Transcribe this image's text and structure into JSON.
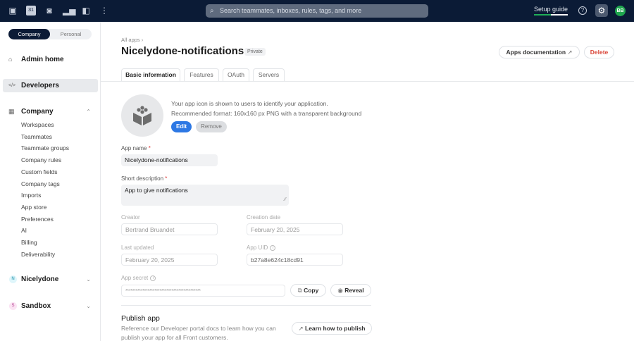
{
  "topbar": {
    "icons": [
      "inbox-icon",
      "calendar-icon",
      "contacts-icon",
      "analytics-icon",
      "knowledge-base-icon",
      "more-icon"
    ],
    "calendar_day": "31",
    "search_placeholder": "Search teammates, inboxes, rules, tags, and more",
    "setup_guide": "Setup guide",
    "setup_progress": 0.5,
    "avatar_initials": "BB"
  },
  "sidebar": {
    "toggle": {
      "company": "Company",
      "personal": "Personal"
    },
    "admin_home": "Admin home",
    "developers": "Developers",
    "company": "Company",
    "company_items": [
      "Workspaces",
      "Teammates",
      "Teammate groups",
      "Company rules",
      "Custom fields",
      "Company tags",
      "Imports",
      "App store",
      "Preferences",
      "AI",
      "Billing",
      "Deliverability"
    ],
    "workspaces": [
      {
        "initial": "N",
        "name": "Nicelydone",
        "color": "#dff6fb"
      },
      {
        "initial": "S",
        "name": "Sandbox",
        "color": "#fbe3f3"
      }
    ]
  },
  "header": {
    "breadcrumb": "All apps",
    "title": "Nicelydone-notifications",
    "badge": "Private",
    "docs_button": "Apps documentation",
    "delete_button": "Delete",
    "tabs": [
      "Basic information",
      "Features",
      "OAuth",
      "Servers"
    ]
  },
  "form": {
    "icon_hint1": "Your app icon is shown to users to identify your application.",
    "icon_hint2": "Recommended format: 160x160 px PNG with a transparent background",
    "edit": "Edit",
    "remove": "Remove",
    "app_name_label": "App name",
    "app_name": "Nicelydone-notifications",
    "short_desc_label": "Short description",
    "short_desc": "App to give notifications",
    "creator_label": "Creator",
    "creator": "Bertrand Bruandet",
    "creation_date_label": "Creation date",
    "creation_date": "February 20, 2025",
    "last_updated_label": "Last updated",
    "last_updated": "February 20, 2025",
    "uid_label": "App UID",
    "uid": "b27a8e624c18cd91",
    "secret_label": "App secret",
    "secret": "********************************************",
    "copy": "Copy",
    "reveal": "Reveal",
    "required": "*"
  },
  "publish": {
    "title": "Publish app",
    "desc1": "Reference our Developer portal docs to learn how you can",
    "desc2": "publish your app for all Front customers.",
    "button": "Learn how to publish"
  }
}
